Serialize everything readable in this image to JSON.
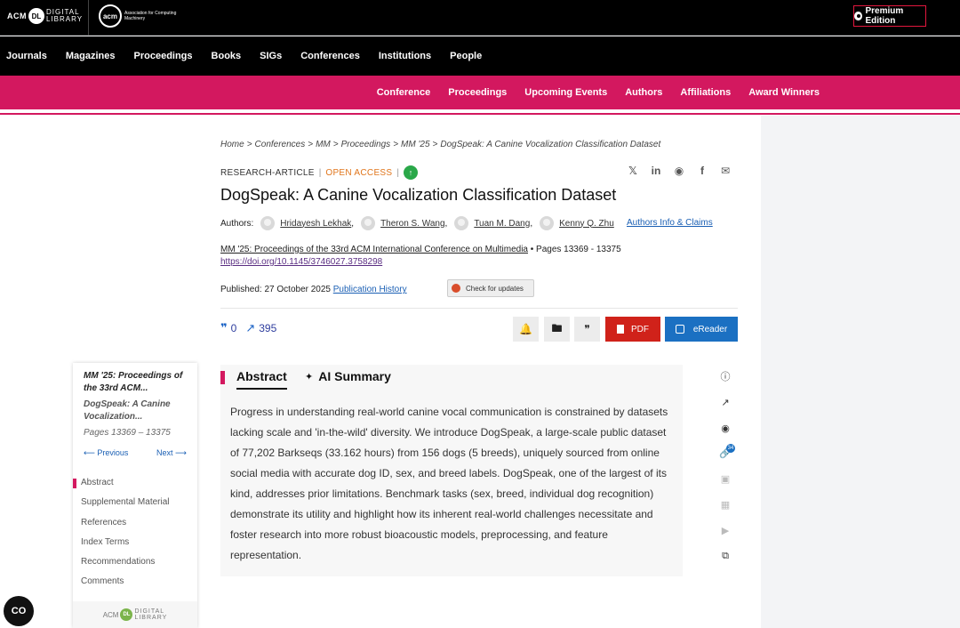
{
  "topbar": {
    "dl_logo": {
      "acm": "ACM",
      "dl": "DL",
      "digital": "DIGITAL",
      "library": "LIBRARY"
    },
    "acm_logo": {
      "mark": "acm",
      "text": "Association for Computing Machinery"
    },
    "premium_label": "Premium Edition"
  },
  "mainnav": [
    "Journals",
    "Magazines",
    "Proceedings",
    "Books",
    "SIGs",
    "Conferences",
    "Institutions",
    "People"
  ],
  "conference_nav": [
    "Conference",
    "Proceedings",
    "Upcoming Events",
    "Authors",
    "Affiliations",
    "Award Winners"
  ],
  "breadcrumb": [
    "Home",
    "Conferences",
    "MM",
    "Proceedings",
    "MM '25",
    "DogSpeak: A Canine Vocalization Classification Dataset"
  ],
  "article": {
    "type": "RESEARCH-ARTICLE",
    "access": "OPEN ACCESS",
    "title": "DogSpeak: A Canine Vocalization Classification Dataset",
    "authors_label": "Authors:",
    "authors": [
      "Hridayesh Lekhak",
      "Theron S. Wang",
      "Tuan M. Dang",
      "Kenny Q. Zhu"
    ],
    "authors_info": "Authors Info & Claims",
    "proceedings": "MM '25: Proceedings of the 33rd ACM International Conference on Multimedia",
    "pages": "Pages 13369 - 13375",
    "doi": "https://doi.org/10.1145/3746027.3758298",
    "published_label": "Published:",
    "published_date": "27 October 2025",
    "publication_history": "Publication History",
    "check_updates": "Check for updates",
    "citations": "0",
    "downloads": "395",
    "pdf_label": "PDF",
    "ereader_label": "eReader"
  },
  "sidebar": {
    "proceedings": "MM '25: Proceedings of the 33rd ACM...",
    "article": "DogSpeak: A Canine Vocalization...",
    "pages": "Pages 13369 – 13375",
    "previous": "Previous",
    "next": "Next",
    "toc": [
      "Abstract",
      "Supplemental Material",
      "References",
      "Index Terms",
      "Recommendations",
      "Comments"
    ],
    "footer": {
      "acm": "ACM",
      "dl": "DL",
      "digital": "DIGITAL",
      "library": "LIBRARY"
    }
  },
  "abstract_panel": {
    "tab_abstract": "Abstract",
    "tab_ai": "AI Summary",
    "text": "Progress in understanding real-world canine vocal communication is constrained by datasets lacking scale and 'in-the-wild' diversity. We introduce DogSpeak, a large-scale public dataset of 77,202 Barkseqs (33.162 hours) from 156 dogs (5 breeds), uniquely sourced from online social media with accurate dog ID, sex, and breed labels. DogSpeak, one of the largest of its kind, addresses prior limitations. Benchmark tasks (sex, breed, individual dog recognition) demonstrate its utility and highlight how its inherent real-world challenges necessitate and foster research into more robust bioacoustic models, preprocessing, and feature representation."
  },
  "side_tools_badge": "34",
  "chat_label": "CO",
  "colors": {
    "accent_pink": "#d3185f",
    "pdf_red": "#d0221a",
    "ereader_blue": "#1b70c2",
    "open_access": "#e0751b"
  }
}
